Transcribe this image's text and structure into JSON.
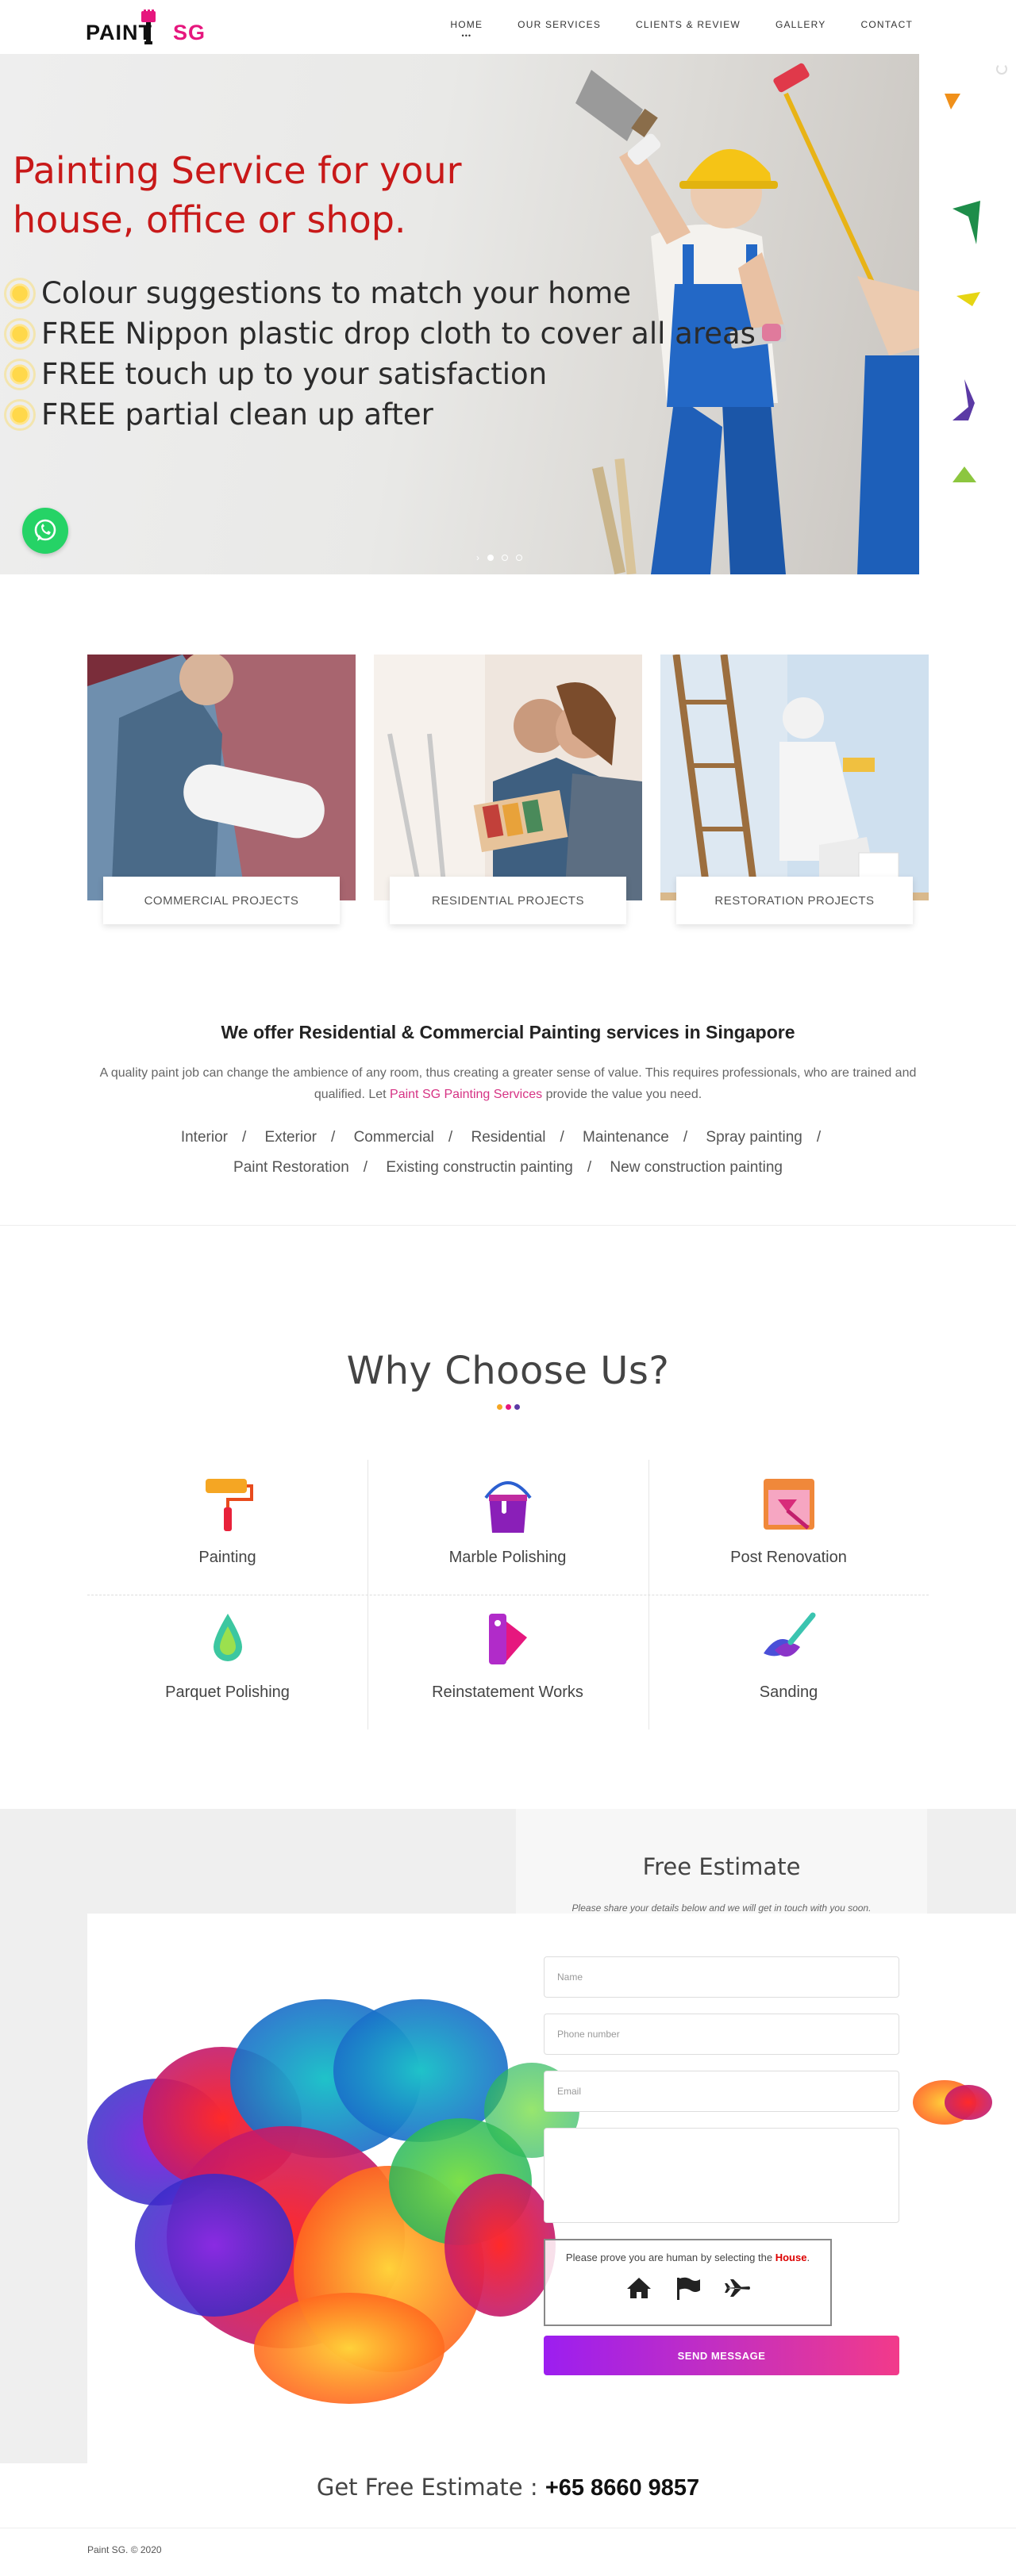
{
  "brand": {
    "logo_text_1": "PAINT",
    "logo_text_2": "SG"
  },
  "nav": {
    "items": [
      {
        "label": "HOME",
        "active": true
      },
      {
        "label": "OUR SERVICES",
        "active": false
      },
      {
        "label": "CLIENTS & REVIEW",
        "active": false
      },
      {
        "label": "GALLERY",
        "active": false
      },
      {
        "label": "CONTACT",
        "active": false
      }
    ]
  },
  "hero": {
    "title": "Painting Service for your house, office or shop.",
    "bullets": [
      "Colour suggestions to match your home",
      "FREE Nippon plastic drop cloth to cover all areas",
      "FREE touch up to your satisfaction",
      "FREE partial clean up after"
    ],
    "slide_count": 3,
    "active_slide": 1
  },
  "projects": [
    {
      "label": "COMMERCIAL PROJECTS"
    },
    {
      "label": "RESIDENTIAL PROJECTS"
    },
    {
      "label": "RESTORATION PROJECTS"
    }
  ],
  "offer": {
    "heading": "We offer Residential & Commercial Painting services in Singapore",
    "text_1": "A quality paint job can change the ambience of any room, thus creating a greater sense of value. This requires professionals, who are trained and qualified. Let ",
    "link": "Paint SG Painting Services",
    "text_2": " provide the value you need.",
    "tags_row1": [
      "Interior",
      "Exterior",
      "Commercial",
      "Residential",
      "Maintenance",
      "Spray painting"
    ],
    "tags_row2": [
      "Paint Restoration",
      "Existing constructin painting",
      "New construction painting"
    ],
    "separator": "/"
  },
  "why": {
    "heading": "Why Choose Us?",
    "features": [
      {
        "label": "Painting",
        "icon": "paint-roller-icon"
      },
      {
        "label": "Marble Polishing",
        "icon": "paint-bucket-icon"
      },
      {
        "label": "Post Renovation",
        "icon": "window-brush-icon"
      },
      {
        "label": "Parquet Polishing",
        "icon": "droplet-icon"
      },
      {
        "label": "Reinstatement Works",
        "icon": "color-swatch-icon"
      },
      {
        "label": "Sanding",
        "icon": "brush-stroke-icon"
      }
    ]
  },
  "estimate": {
    "title": "Free Estimate",
    "subtitle": "Please share your details below and we will get in touch with you soon.",
    "name_placeholder": "Name",
    "phone_placeholder": "Phone number",
    "email_placeholder": "Email",
    "message_placeholder": "",
    "captcha_text": "Please prove you are human by selecting the ",
    "captcha_target": "House",
    "captcha_end": ".",
    "send_label": "SEND MESSAGE"
  },
  "contact_line": {
    "label": "Get Free Estimate : ",
    "phone": "+65 8660 9857"
  },
  "footer": {
    "copyright": "Paint SG. © 2020"
  },
  "colors": {
    "accent_pink": "#e6177e",
    "hero_red": "#c81919",
    "whatsapp": "#25d366"
  }
}
